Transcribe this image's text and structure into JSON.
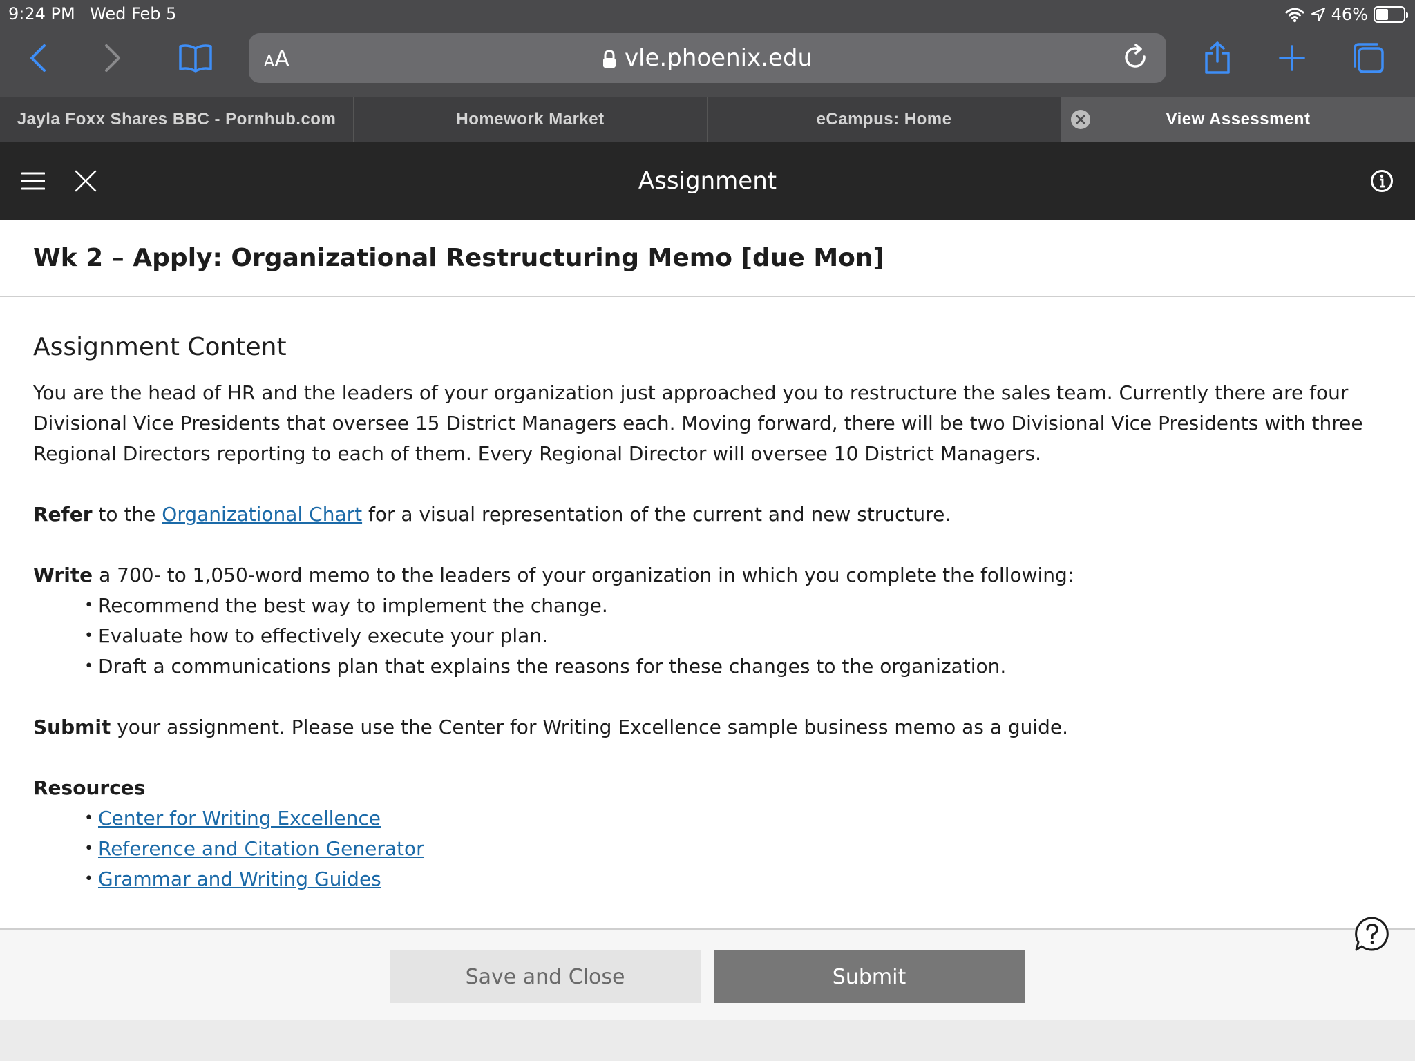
{
  "status_bar": {
    "time": "9:24 PM",
    "date": "Wed Feb 5",
    "battery": "46%",
    "battery_level": 0.46,
    "icons": [
      "wifi-icon",
      "location-icon",
      "battery-icon"
    ]
  },
  "browser": {
    "aa_label_small": "A",
    "aa_label_large": "A",
    "url": "vle.phoenix.edu",
    "icons": [
      "back-icon",
      "forward-icon",
      "bookmarks-icon",
      "lock-icon",
      "reload-icon",
      "share-icon",
      "new-tab-icon",
      "tabs-icon"
    ],
    "accent_color": "#3e8ef7"
  },
  "tabs": [
    {
      "label": "Jayla Foxx Shares BBC - Pornhub.com",
      "active": false
    },
    {
      "label": "Homework Market",
      "active": false
    },
    {
      "label": "eCampus: Home",
      "active": false
    },
    {
      "label": "View Assessment",
      "active": true
    }
  ],
  "app_header": {
    "title": "Assignment",
    "icons": [
      "menu-icon",
      "close-icon",
      "info-icon"
    ]
  },
  "assignment": {
    "title": "Wk 2 – Apply: Organizational Restructuring Memo [due Mon]",
    "content_heading": "Assignment Content",
    "intro": "You are the head of HR and the leaders of your organization just approached you to restructure the sales team. Currently there are four Divisional Vice Presidents that oversee 15 District Managers each. Moving forward, there will be two Divisional Vice Presidents with three Regional Directors reporting to each of them. Every Regional Director will oversee 10 District Managers.",
    "refer": {
      "bold": "Refer",
      "pre": " to the ",
      "link": "Organizational Chart",
      "post": " for a visual representation of the current and new structure."
    },
    "write": {
      "bold": "Write",
      "text": " a 700- to 1,050-word memo to the leaders of your organization in which you complete the following:",
      "bullets": [
        "Recommend the best way to implement the change.",
        "Evaluate how to effectively execute your plan.",
        "Draft a communications plan that explains the reasons for these changes to the organization."
      ]
    },
    "submit": {
      "bold": "Submit",
      "text": " your assignment. Please use the Center for Writing Excellence sample business memo as a guide."
    },
    "resources": {
      "heading": "Resources",
      "links": [
        "Center for Writing Excellence",
        "Reference and Citation Generator",
        "Grammar and Writing Guides"
      ]
    }
  },
  "footer": {
    "save_label": "Save and Close",
    "submit_label": "Submit",
    "icons": [
      "help-icon"
    ]
  }
}
